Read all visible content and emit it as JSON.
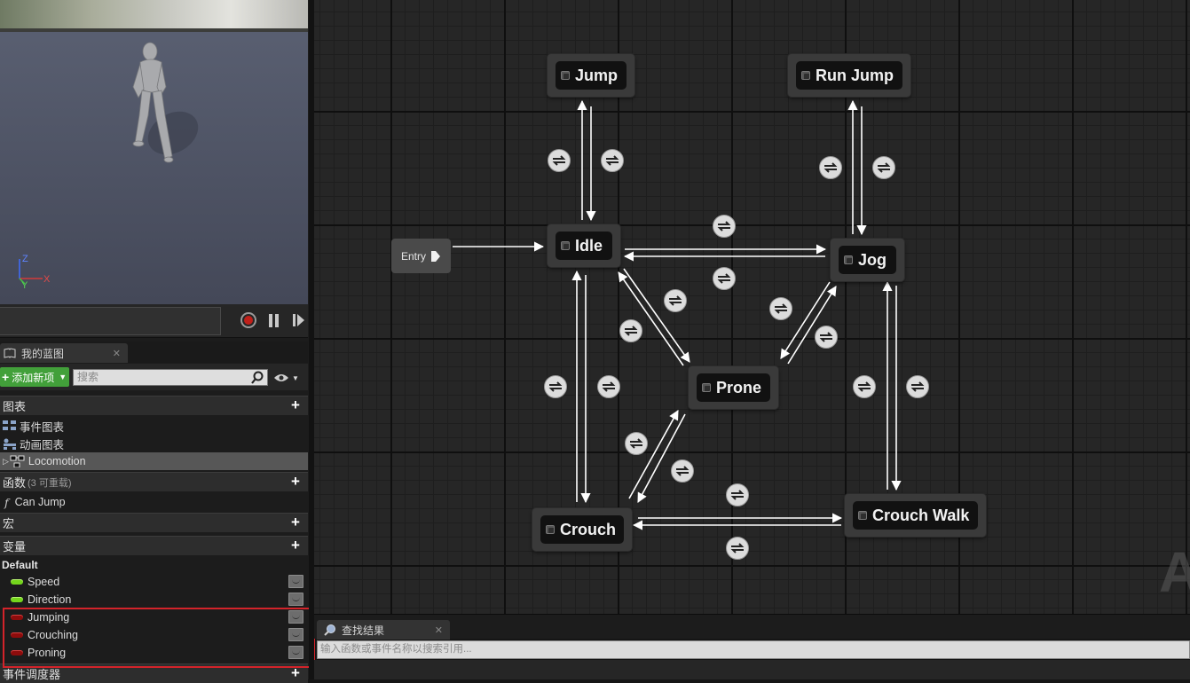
{
  "blueprint_panel": {
    "tab_label": "我的蓝图",
    "add_button_label": "添加新项",
    "search_placeholder": "搜索",
    "sections": {
      "graphs": {
        "title": "图表",
        "items": [
          "事件图表",
          "动画图表",
          "Locomotion"
        ]
      },
      "functions": {
        "title": "函数",
        "subtitle": "(3 可重载)",
        "items": [
          "Can Jump"
        ]
      },
      "macros": {
        "title": "宏"
      },
      "variables": {
        "title": "变量",
        "category": "Default",
        "items": [
          {
            "name": "Speed",
            "type": "float",
            "color": "#74d51c"
          },
          {
            "name": "Direction",
            "type": "float",
            "color": "#74d51c"
          },
          {
            "name": "Jumping",
            "type": "bool",
            "color": "#8e0c0c"
          },
          {
            "name": "Crouching",
            "type": "bool",
            "color": "#8e0c0c"
          },
          {
            "name": "Proning",
            "type": "bool",
            "color": "#8e0c0c"
          }
        ]
      },
      "event_dispatchers": {
        "title": "事件调度器"
      }
    },
    "highlight_color": "#d3232a"
  },
  "viewport": {
    "axis_labels": {
      "z": "Z",
      "y": "Y",
      "x": "X"
    }
  },
  "state_machine": {
    "entry_label": "Entry",
    "states": [
      "Jump",
      "Run Jump",
      "Idle",
      "Jog",
      "Prone",
      "Crouch",
      "Crouch Walk"
    ],
    "watermark": "A"
  },
  "find_results": {
    "tab_label": "查找结果",
    "search_placeholder": "输入函数或事件名称以搜索引用..."
  }
}
